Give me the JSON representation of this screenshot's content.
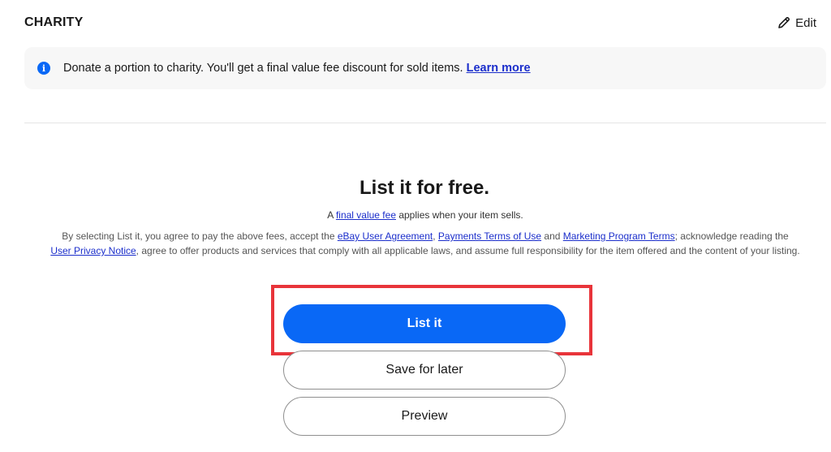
{
  "charity": {
    "title": "CHARITY",
    "edit_label": "Edit",
    "edit_icon": "pencil-icon",
    "info_icon": "info-icon",
    "banner_text": "Donate a portion to charity. You'll get a final value fee discount for sold items. ",
    "banner_link": "Learn more"
  },
  "listing": {
    "title": "List it for free.",
    "fee_prefix": "A ",
    "fee_link": "final value fee",
    "fee_suffix": " applies when your item sells.",
    "legal": {
      "p1": "By selecting List it, you agree to pay the above fees, accept the ",
      "link1": "eBay User Agreement",
      "p2": ", ",
      "link2": "Payments Terms of Use",
      "p3": " and ",
      "link3": "Marketing Program Terms",
      "p4": "; acknowledge reading the ",
      "link4": "User Privacy Notice",
      "p5": ", agree to offer products and services that comply with all applicable laws, and assume full responsibility for the item offered and the content of your listing."
    },
    "buttons": {
      "list_it": "List it",
      "save_for_later": "Save for later",
      "preview": "Preview"
    }
  },
  "colors": {
    "primary": "#0968f6",
    "link": "#1b2ecb",
    "highlight": "#e8343a",
    "banner_bg": "#f7f7f7"
  }
}
